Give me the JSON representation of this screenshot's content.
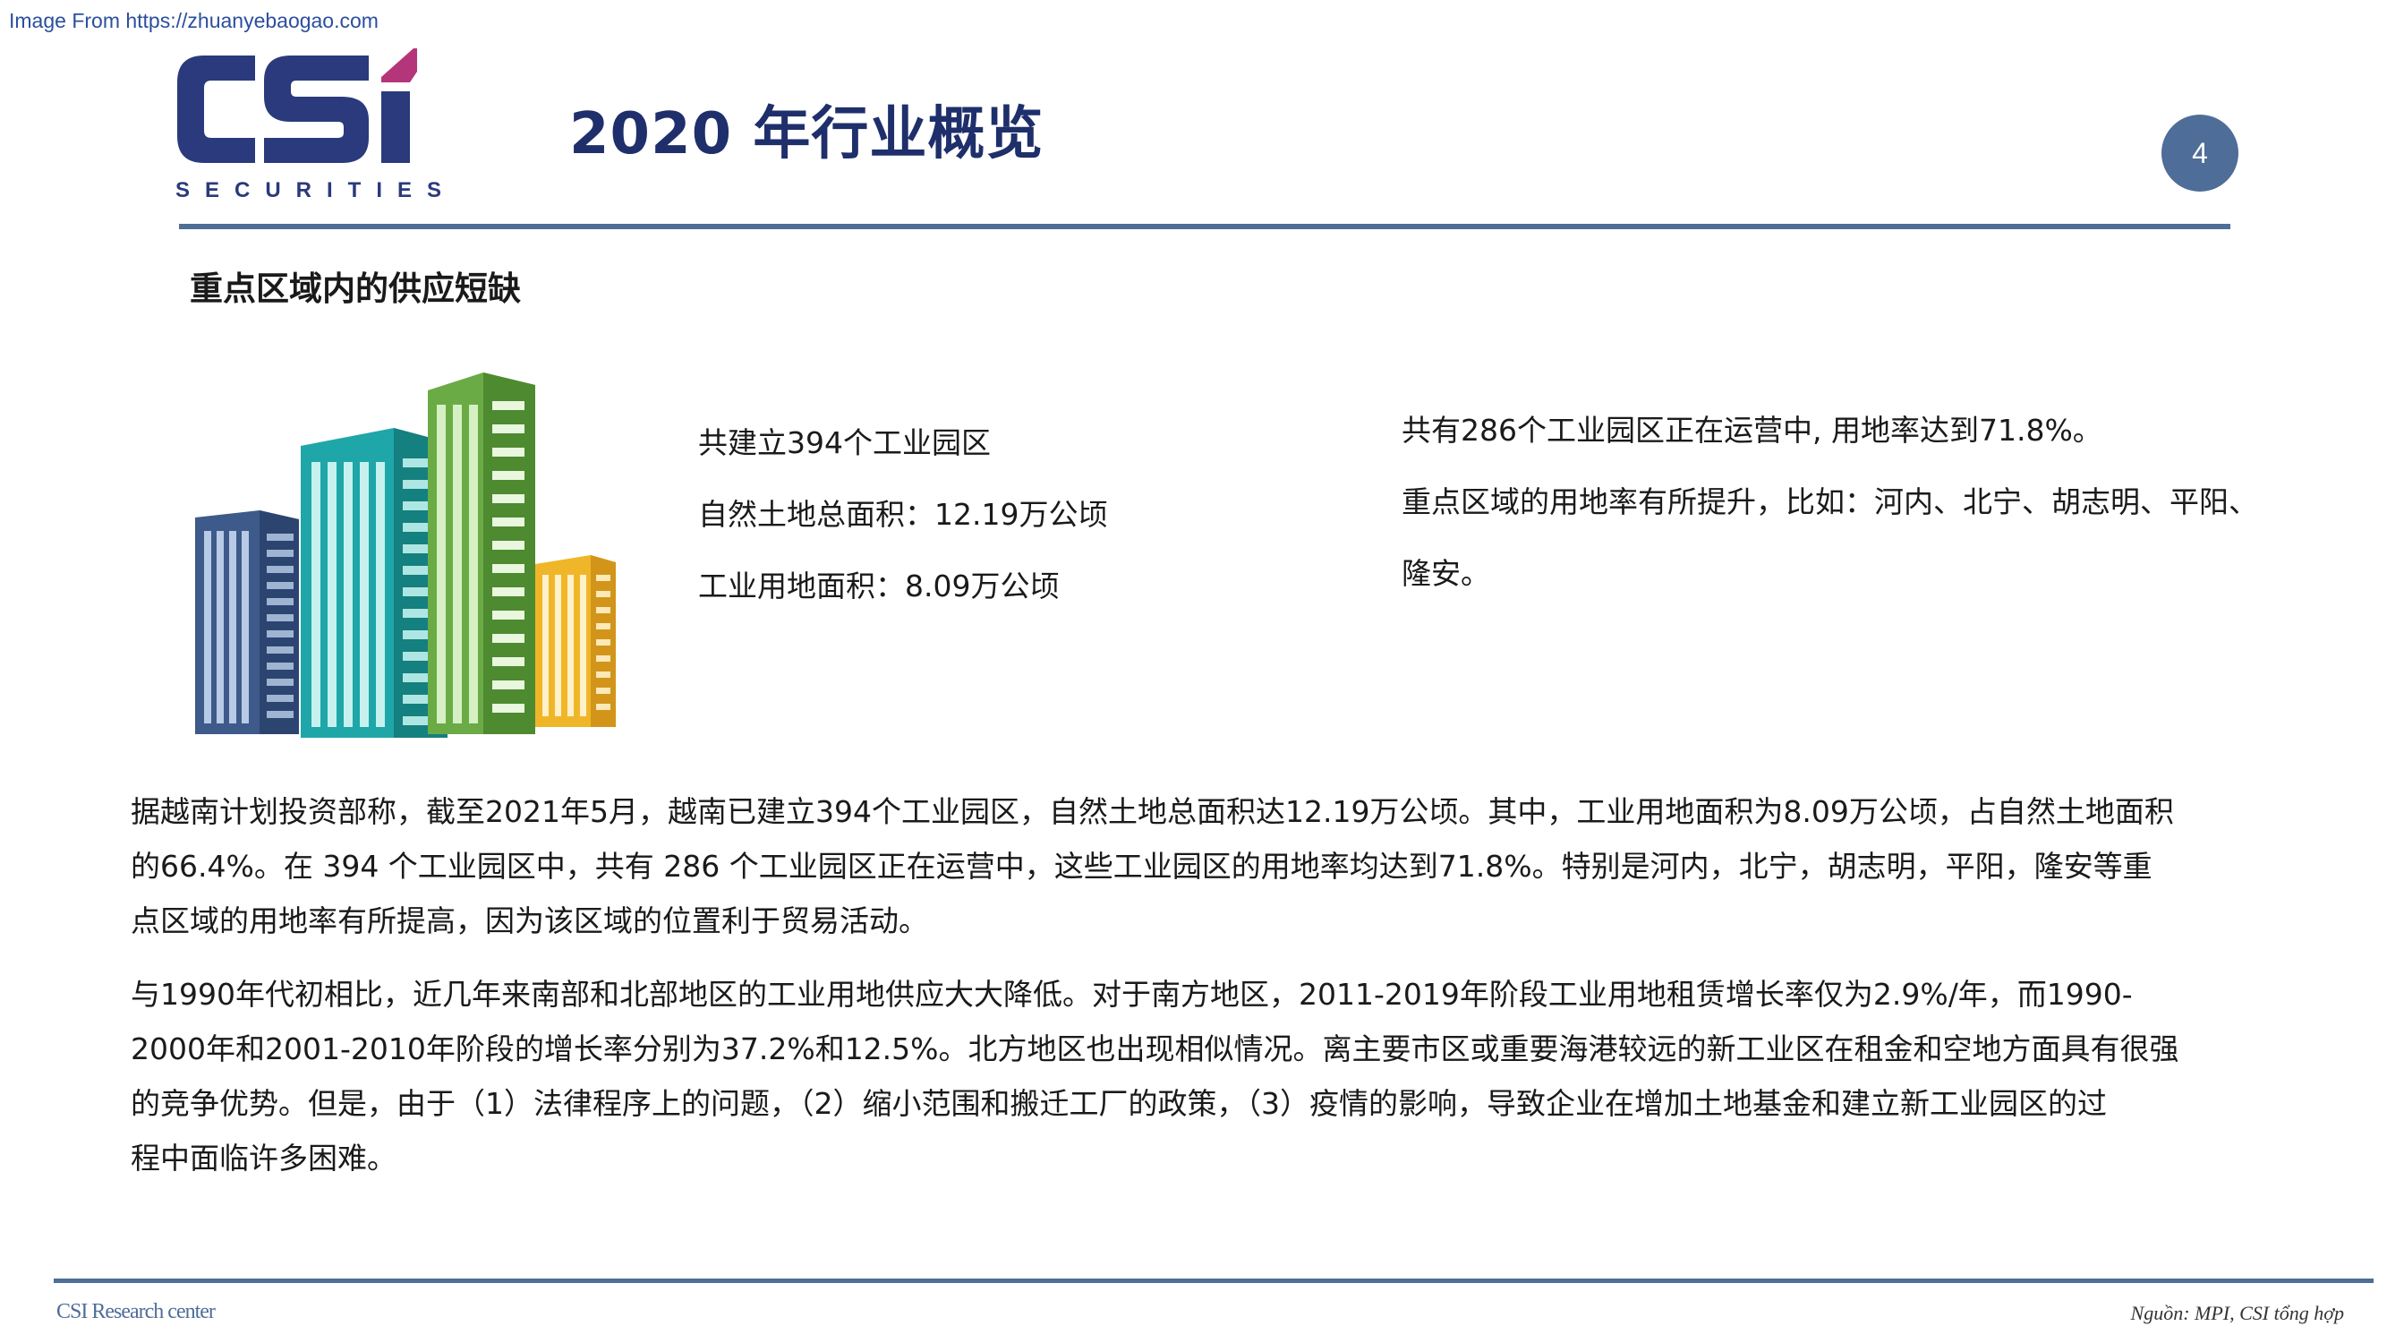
{
  "watermark": "Image From https://zhuanyebaogao.com",
  "logo": {
    "wordmark": "CSI",
    "subtext": "SECURITIES"
  },
  "title": "2020 年行业概览",
  "page_number": "4",
  "section_heading": "重点区域内的供应短缺",
  "stats": [
    "共建立394个工业园区",
    "自然土地总面积：12.19万公顷",
    "工业用地面积：8.09万公顷"
  ],
  "highlights": [
    "共有286个工业园区正在运营中, 用地率达到71.8%。",
    "重点区域的用地率有所提升，比如：河内、北宁、胡志明、平阳、",
    "隆安。"
  ],
  "paragraph1_lines": [
    "据越南计划投资部称，截至2021年5月，越南已建立394个工业园区，自然土地总面积达12.19万公顷。其中，工业用地面积为8.09万公顷，占自然土地面积",
    "的66.4%。在 394 个工业园区中，共有 286 个工业园区正在运营中，这些工业园区的用地率均达到71.8%。特别是河内，北宁，胡志明，平阳，隆安等重",
    "点区域的用地率有所提高，因为该区域的位置利于贸易活动。"
  ],
  "paragraph2_lines": [
    "与1990年代初相比，近几年来南部和北部地区的工业用地供应大大降低。对于南方地区，2011-2019年阶段工业用地租赁增长率仅为2.9%/年，而1990-",
    "2000年和2001-2010年阶段的增长率分别为37.2%和12.5%。北方地区也出现相似情况。离主要市区或重要海港较远的新工业区在租金和空地方面具有很强",
    "的竞争优势。但是，由于（1）法律程序上的问题，（2）缩小范围和搬迁工厂的政策，（3）疫情的影响，导致企业在增加土地基金和建立新工业园区的过",
    "程中面临许多困难。"
  ],
  "footer": {
    "left": "CSI Research center",
    "right": "Nguồn: MPI, CSI tổng hợp"
  },
  "colors": {
    "title": "#1f2f6b",
    "accent": "#4e6d98",
    "logo_navy": "#2a3a7c",
    "logo_magenta": "#b5357a",
    "building_navy": "#3d5a8a",
    "building_teal": "#1fa6a8",
    "building_green": "#6aab46",
    "building_yellow": "#f0b62a"
  }
}
